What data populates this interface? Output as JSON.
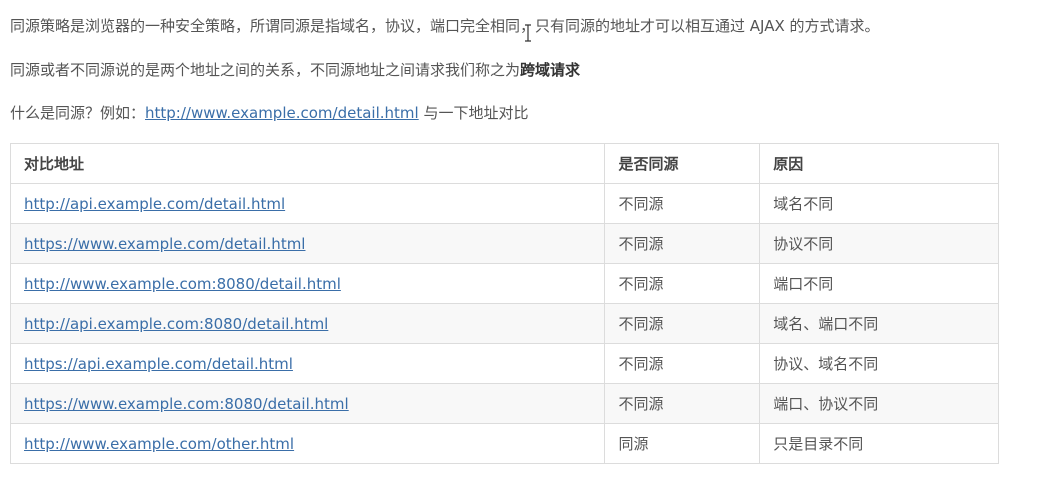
{
  "intro": {
    "line1": "同源策略是浏览器的一种安全策略，所谓同源是指域名，协议，端口完全相同，只有同源的地址才可以相互通过 AJAX 的方式请求。",
    "line2_prefix": "同源或者不同源说的是两个地址之间的关系，不同源地址之间请求我们称之为",
    "line2_bold": "跨域请求",
    "line3_prefix": "什么是同源？例如：",
    "line3_link": "http://www.example.com/detail.html",
    "line3_suffix": " 与一下地址对比"
  },
  "table": {
    "headers": [
      "对比地址",
      "是否同源",
      "原因"
    ],
    "rows": [
      {
        "url": "http://api.example.com/detail.html",
        "same": "不同源",
        "reason": "域名不同"
      },
      {
        "url": "https://www.example.com/detail.html",
        "same": "不同源",
        "reason": "协议不同"
      },
      {
        "url": "http://www.example.com:8080/detail.html",
        "same": "不同源",
        "reason": "端口不同"
      },
      {
        "url": "http://api.example.com:8080/detail.html",
        "same": "不同源",
        "reason": "域名、端口不同"
      },
      {
        "url": "https://api.example.com/detail.html",
        "same": "不同源",
        "reason": "协议、域名不同"
      },
      {
        "url": "https://www.example.com:8080/detail.html",
        "same": "不同源",
        "reason": "端口、协议不同"
      },
      {
        "url": "http://www.example.com/other.html",
        "same": "同源",
        "reason": "只是目录不同"
      }
    ]
  },
  "icons": {
    "cursor": "text-cursor-icon"
  },
  "colors": {
    "link": "#3a6ea8",
    "text": "#555555",
    "border": "#dcdcdc"
  }
}
